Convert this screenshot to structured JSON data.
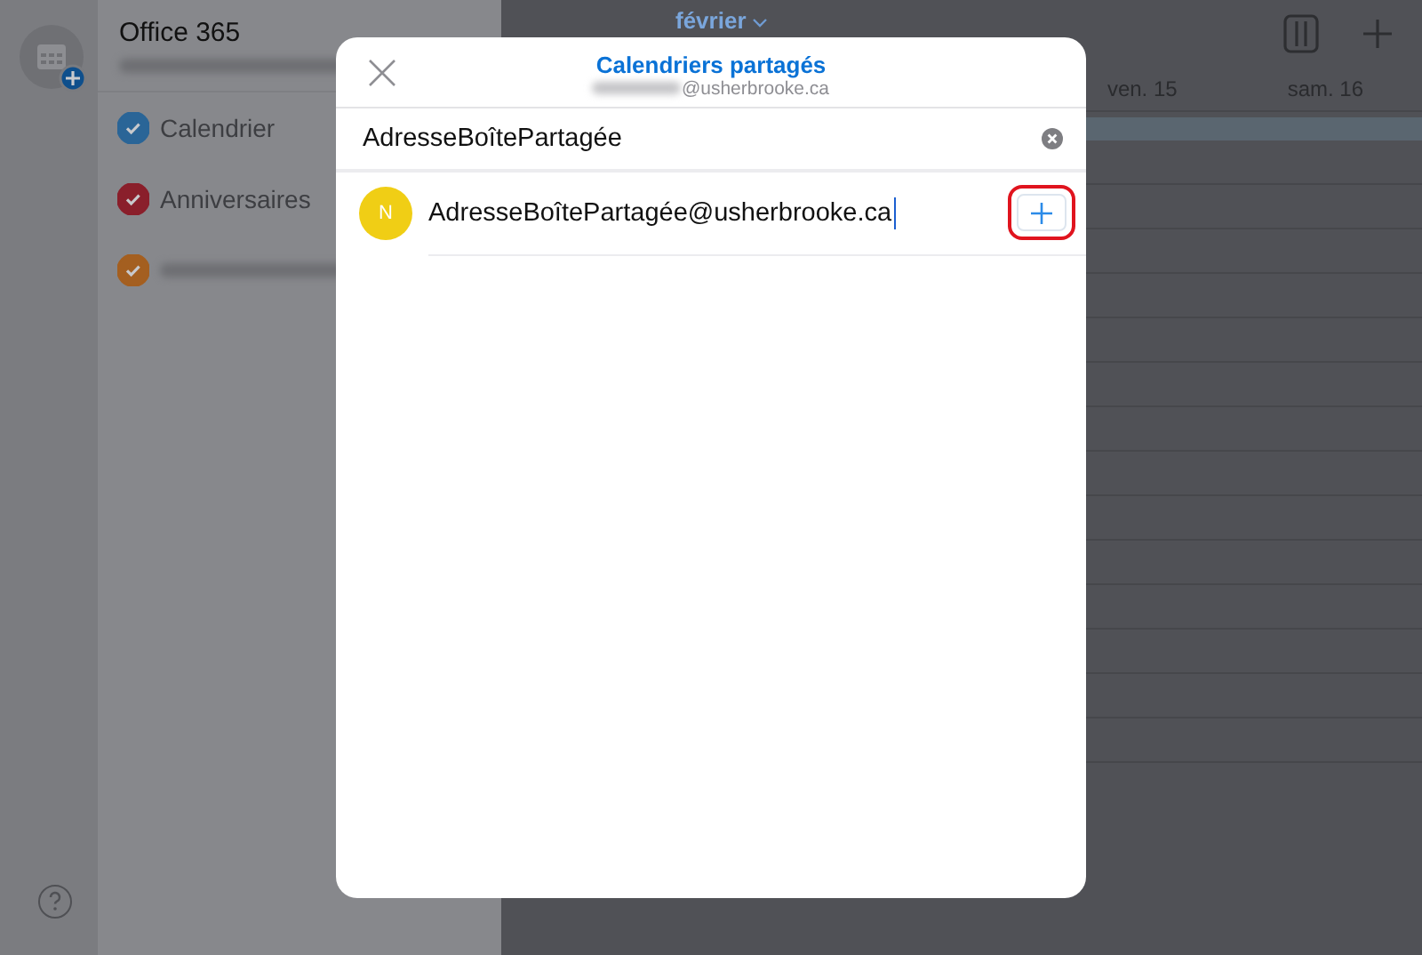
{
  "sidebar": {
    "account": "Office 365",
    "calendars": [
      {
        "label": "Calendrier",
        "checked": true,
        "color": "#2a6597"
      },
      {
        "label": "Anniversaires",
        "checked": true,
        "color": "#8a1f2b"
      },
      {
        "checked": true,
        "color": "#a45f20"
      }
    ]
  },
  "calendar": {
    "month": "février",
    "days": [
      "ven. 15",
      "sam. 16"
    ]
  },
  "dialog": {
    "title": "Calendriers partagés",
    "subtitle": "@usherbrooke.ca",
    "search": {
      "value": "AdresseBoîtePartagée"
    },
    "results": [
      {
        "initial": "N",
        "address": "AdresseBoîtePartagée@usherbrooke.ca"
      }
    ]
  }
}
